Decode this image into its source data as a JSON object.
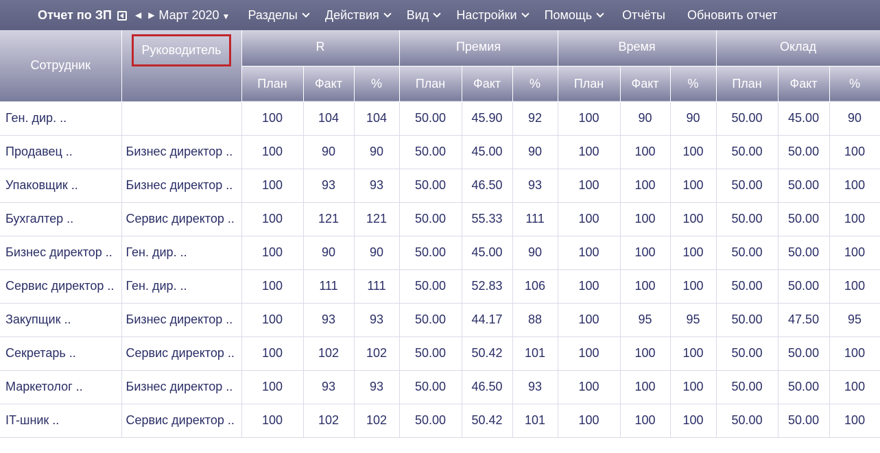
{
  "toolbar": {
    "title": "Отчет по ЗП",
    "month": "Март 2020",
    "menus": [
      "Разделы",
      "Действия",
      "Вид",
      "Настройки",
      "Помощь"
    ],
    "reports": "Отчёты",
    "refresh": "Обновить отчет"
  },
  "header": {
    "employee": "Сотрудник",
    "manager": "Руководитель",
    "groups": [
      "R",
      "Премия",
      "Время",
      "Оклад"
    ],
    "sub": [
      "План",
      "Факт",
      "%"
    ]
  },
  "rows": [
    {
      "emp": "Ген. дир. ..",
      "mgr": "",
      "vals": [
        "100",
        "104",
        "104",
        "50.00",
        "45.90",
        "92",
        "100",
        "90",
        "90",
        "50.00",
        "45.00",
        "90"
      ]
    },
    {
      "emp": "Продавец ..",
      "mgr": "Бизнес директор ..",
      "vals": [
        "100",
        "90",
        "90",
        "50.00",
        "45.00",
        "90",
        "100",
        "100",
        "100",
        "50.00",
        "50.00",
        "100"
      ]
    },
    {
      "emp": "Упаковщик ..",
      "mgr": "Бизнес директор ..",
      "vals": [
        "100",
        "93",
        "93",
        "50.00",
        "46.50",
        "93",
        "100",
        "100",
        "100",
        "50.00",
        "50.00",
        "100"
      ]
    },
    {
      "emp": "Бухгалтер ..",
      "mgr": "Сервис директор ..",
      "vals": [
        "100",
        "121",
        "121",
        "50.00",
        "55.33",
        "111",
        "100",
        "100",
        "100",
        "50.00",
        "50.00",
        "100"
      ]
    },
    {
      "emp": "Бизнес директор ..",
      "mgr": "Ген. дир. ..",
      "vals": [
        "100",
        "90",
        "90",
        "50.00",
        "45.00",
        "90",
        "100",
        "100",
        "100",
        "50.00",
        "50.00",
        "100"
      ]
    },
    {
      "emp": "Сервис директор ..",
      "mgr": "Ген. дир. ..",
      "vals": [
        "100",
        "111",
        "111",
        "50.00",
        "52.83",
        "106",
        "100",
        "100",
        "100",
        "50.00",
        "50.00",
        "100"
      ]
    },
    {
      "emp": "Закупщик ..",
      "mgr": "Бизнес директор ..",
      "vals": [
        "100",
        "93",
        "93",
        "50.00",
        "44.17",
        "88",
        "100",
        "95",
        "95",
        "50.00",
        "47.50",
        "95"
      ]
    },
    {
      "emp": "Секретарь ..",
      "mgr": "Сервис директор ..",
      "vals": [
        "100",
        "102",
        "102",
        "50.00",
        "50.42",
        "101",
        "100",
        "100",
        "100",
        "50.00",
        "50.00",
        "100"
      ]
    },
    {
      "emp": "Маркетолог ..",
      "mgr": "Бизнес директор ..",
      "vals": [
        "100",
        "93",
        "93",
        "50.00",
        "46.50",
        "93",
        "100",
        "100",
        "100",
        "50.00",
        "50.00",
        "100"
      ]
    },
    {
      "emp": "IT-шник ..",
      "mgr": "Сервис директор ..",
      "vals": [
        "100",
        "102",
        "102",
        "50.00",
        "50.42",
        "101",
        "100",
        "100",
        "100",
        "50.00",
        "50.00",
        "100"
      ]
    }
  ],
  "colors": {
    "toolbar_bg": "#65678a",
    "header_top": "#d2d2e0",
    "header_bottom": "#7a7c9c",
    "text": "#2a2e66",
    "highlight": "#c0262c"
  }
}
